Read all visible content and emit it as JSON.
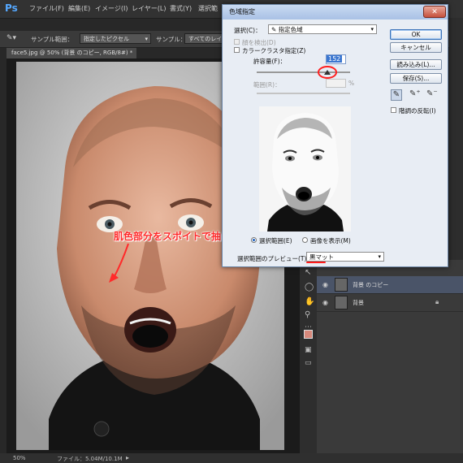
{
  "app": {
    "logo": "Ps"
  },
  "menu": [
    "ファイル(F)",
    "編集(E)",
    "イメージ(I)",
    "レイヤー(L)",
    "書式(Y)",
    "選択範"
  ],
  "options": {
    "sample_label": "サンプル範囲：",
    "sample_value": "指定したピクセル",
    "sample2_label": "サンプル：",
    "sample2_value": "すべてのレイヤー"
  },
  "document": {
    "tab": "face5.jpg @ 50% (背景 のコピー, RGB/8#) *",
    "zoom": "50%",
    "file_info": "ファイル：5.04M/10.1M"
  },
  "dialog": {
    "title": "色域指定",
    "close_label": "✕",
    "select_label": "選択(C)：",
    "select_value": "指定色域",
    "detect_faces": "顔を検出(D)",
    "localized_clusters": "カラークラスタ指定(Z)",
    "fuzziness_label": "許容量(F)：",
    "fuzziness_value": "152",
    "range_label": "範囲(R)：",
    "range_unit": "%",
    "radio_selection": "選択範囲(E)",
    "radio_image": "画像を表示(M)",
    "preview_label": "選択範囲のプレビュー(T)：",
    "preview_value": "黒マット",
    "ok": "OK",
    "cancel": "キャンセル",
    "load": "読み込み(L)...",
    "save": "保存(S)...",
    "invert": "階調の反転(I)",
    "fuzziness_fraction": 0.76
  },
  "annotation": "肌色部分をスポイトで抽出",
  "layers": [
    {
      "name": "背景 のコピー",
      "selected": true
    },
    {
      "name": "背景",
      "selected": false
    }
  ],
  "colors": {
    "accent_red": "#ff2a2a",
    "dialog_bg": "#e8edf4",
    "ps_dark": "#282828"
  }
}
